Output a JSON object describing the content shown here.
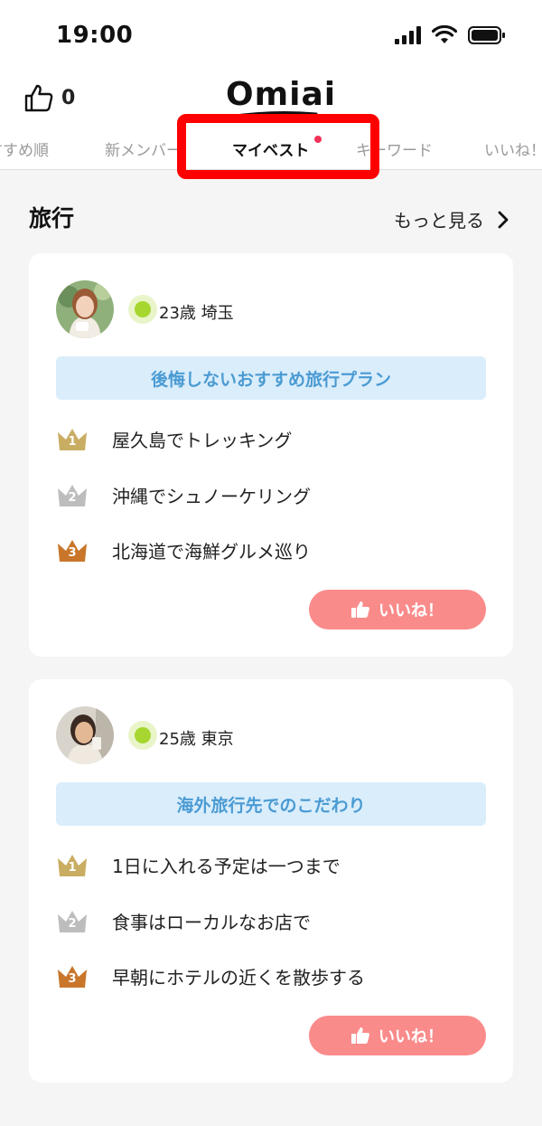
{
  "status": {
    "time": "19:00"
  },
  "header": {
    "like_count": "0",
    "logo": "Omiai"
  },
  "tabs": [
    {
      "label": "すすめ順"
    },
    {
      "label": "新メンバー"
    },
    {
      "label": "マイベスト"
    },
    {
      "label": "キーワード"
    },
    {
      "label": "いいね！"
    }
  ],
  "section": {
    "title": "旅行",
    "more": "もっと見る"
  },
  "cards": [
    {
      "age_location": "23歳 埼玉",
      "plan_title": "後悔しないおすすめ旅行プラン",
      "ranks": [
        {
          "num": "1",
          "text": "屋久島でトレッキング"
        },
        {
          "num": "2",
          "text": "沖縄でシュノーケリング"
        },
        {
          "num": "3",
          "text": "北海道で海鮮グルメ巡り"
        }
      ],
      "like_label": "いいね！"
    },
    {
      "age_location": "25歳 東京",
      "plan_title": "海外旅行先でのこだわり",
      "ranks": [
        {
          "num": "1",
          "text": "1日に入れる予定は一つまで"
        },
        {
          "num": "2",
          "text": "食事はローカルなお店で"
        },
        {
          "num": "3",
          "text": "早朝にホテルの近くを散歩する"
        }
      ],
      "like_label": "いいね！"
    }
  ],
  "colors": {
    "accent_red": "#ff0000",
    "like_pink": "#fa8b8b",
    "banner_blue": "#daedfb",
    "banner_text": "#4a9bd3",
    "gold": "#c9ad62",
    "silver": "#bdbdbd",
    "bronze": "#c9762b",
    "online": "#a7d630"
  }
}
